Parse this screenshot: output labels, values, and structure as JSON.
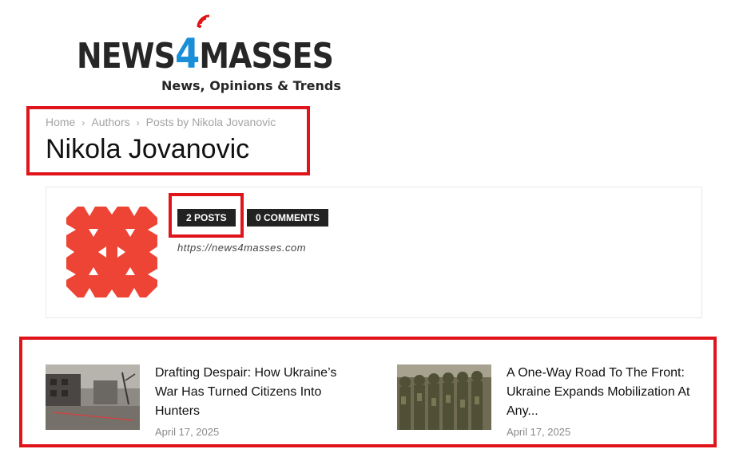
{
  "brand": {
    "name_left": "NEWS",
    "name_num": "4",
    "name_right": "MASSES",
    "tagline": "News, Opinions & Trends",
    "colors": {
      "accent": "#1a8fd8",
      "signal": "#e0151c",
      "text": "#262626"
    }
  },
  "breadcrumb": {
    "items": [
      "Home",
      "Authors",
      "Posts by Nikola Jovanovic"
    ],
    "separator": "›"
  },
  "page": {
    "title": "Nikola Jovanovic"
  },
  "author": {
    "posts_badge": "2 POSTS",
    "comments_badge": "0 COMMENTS",
    "url": "https://news4masses.com",
    "avatar_color": "#ee4435"
  },
  "posts": [
    {
      "title": "Drafting Despair: How Ukraine’s War Has Turned Citizens Into Hunters",
      "date": "April 17, 2025",
      "thumbnail": "destroyed-building-photo"
    },
    {
      "title": "A One-Way Road To The Front: Ukraine Expands Mobilization At Any...",
      "date": "April 17, 2025",
      "thumbnail": "soldiers-formation-photo"
    }
  ],
  "highlight_color": "#e0151c"
}
